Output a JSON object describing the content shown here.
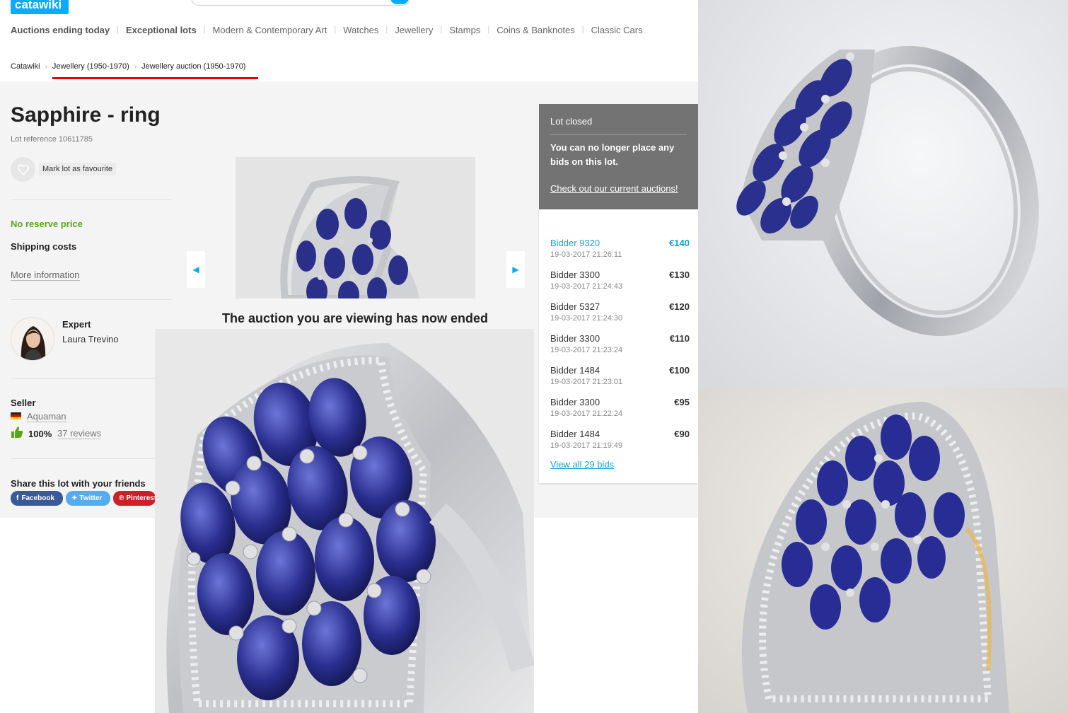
{
  "header": {
    "logo_text": "catawiki",
    "nav": [
      {
        "label": "Auctions ending today",
        "bold": true
      },
      {
        "label": "Exceptional lots",
        "bold": true
      },
      {
        "label": "Modern & Contemporary Art",
        "bold": false
      },
      {
        "label": "Watches",
        "bold": false
      },
      {
        "label": "Jewellery",
        "bold": false
      },
      {
        "label": "Stamps",
        "bold": false
      },
      {
        "label": "Coins & Banknotes",
        "bold": false
      },
      {
        "label": "Classic Cars",
        "bold": false
      }
    ]
  },
  "breadcrumb": [
    "Catawiki",
    "Jewellery (1950-1970)",
    "Jewellery auction (1950-1970)"
  ],
  "lot": {
    "title": "Sapphire - ring",
    "reference": "Lot reference 10611785",
    "favourite_label": "Mark lot as favourite",
    "no_reserve": "No reserve price",
    "shipping": "Shipping costs",
    "more_info": "More information",
    "expert_title": "Expert",
    "expert_name": "Laura Trevino",
    "seller_title": "Seller",
    "seller_name": "Aquaman",
    "seller_rating": "100%",
    "seller_reviews": "37 reviews",
    "share_title": "Share this lot with your friends",
    "share_facebook": "Facebook",
    "share_twitter": "Twitter",
    "share_pinterest": "Pinterest",
    "ended_message": "The auction you are viewing has now ended"
  },
  "status": {
    "head": "Lot closed",
    "message": "You can no longer place any bids on this lot.",
    "link": "Check out our current auctions!"
  },
  "bids": [
    {
      "bidder": "Bidder 9320",
      "time": "19-03-2017 21:26:11",
      "amount": "€140"
    },
    {
      "bidder": "Bidder 3300",
      "time": "19-03-2017 21:24:43",
      "amount": "€130"
    },
    {
      "bidder": "Bidder 5327",
      "time": "19-03-2017 21:24:30",
      "amount": "€120"
    },
    {
      "bidder": "Bidder 3300",
      "time": "19-03-2017 21:23:24",
      "amount": "€110"
    },
    {
      "bidder": "Bidder 1484",
      "time": "19-03-2017 21:23:01",
      "amount": "€100"
    },
    {
      "bidder": "Bidder 3300",
      "time": "19-03-2017 21:22:24",
      "amount": "€95"
    },
    {
      "bidder": "Bidder 1484",
      "time": "19-03-2017 21:19:49",
      "amount": "€90"
    }
  ],
  "view_all_bids": "View all 29 bids",
  "icons": {
    "heart": "heart-icon",
    "prev": "chevron-left-icon",
    "next": "chevron-right-icon",
    "thumb": "thumbs-up-icon",
    "flag": "flag-de-icon"
  },
  "colors": {
    "brand": "#0aaaff",
    "accent_green": "#5aa51e",
    "breadcrumb_underline": "#e8000b",
    "status_panel": "#737373",
    "highest_bid": "#15a2e0",
    "facebook": "#3b5998",
    "twitter": "#55acee",
    "pinterest": "#cb2027"
  }
}
